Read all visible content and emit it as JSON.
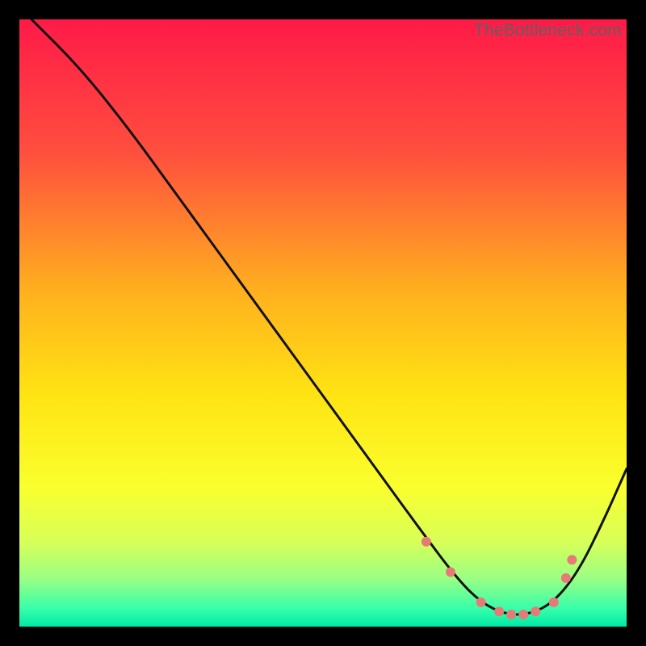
{
  "watermark": "TheBottleneck.com",
  "chart_data": {
    "type": "line",
    "title": "",
    "xlabel": "",
    "ylabel": "",
    "xlim": [
      0,
      100
    ],
    "ylim": [
      0,
      100
    ],
    "grid": false,
    "legend": false,
    "background_gradient_stops": [
      {
        "offset": 0.0,
        "color": "#ff1a48"
      },
      {
        "offset": 0.22,
        "color": "#ff4f3e"
      },
      {
        "offset": 0.45,
        "color": "#ffb11e"
      },
      {
        "offset": 0.62,
        "color": "#ffe413"
      },
      {
        "offset": 0.77,
        "color": "#faff2e"
      },
      {
        "offset": 0.86,
        "color": "#d8ff58"
      },
      {
        "offset": 0.92,
        "color": "#9bff83"
      },
      {
        "offset": 0.97,
        "color": "#38ffaa"
      },
      {
        "offset": 1.0,
        "color": "#00e9a6"
      }
    ],
    "series": [
      {
        "name": "bottleneck-curve",
        "x": [
          2,
          10,
          18,
          26,
          34,
          42,
          50,
          58,
          66,
          72,
          76,
          80,
          84,
          88,
          92,
          96,
          100
        ],
        "y": [
          100,
          92,
          82,
          71,
          60,
          49,
          38,
          27,
          16,
          8,
          4,
          2,
          2,
          4,
          9,
          17,
          26
        ]
      }
    ],
    "markers": {
      "name": "highlight-dots",
      "color": "#e77a76",
      "radius_px": 6,
      "x": [
        67,
        71,
        76,
        79,
        81,
        83,
        85,
        88,
        90,
        91
      ],
      "y": [
        14,
        9,
        4,
        2.5,
        2,
        2,
        2.5,
        4,
        8,
        11
      ]
    }
  }
}
